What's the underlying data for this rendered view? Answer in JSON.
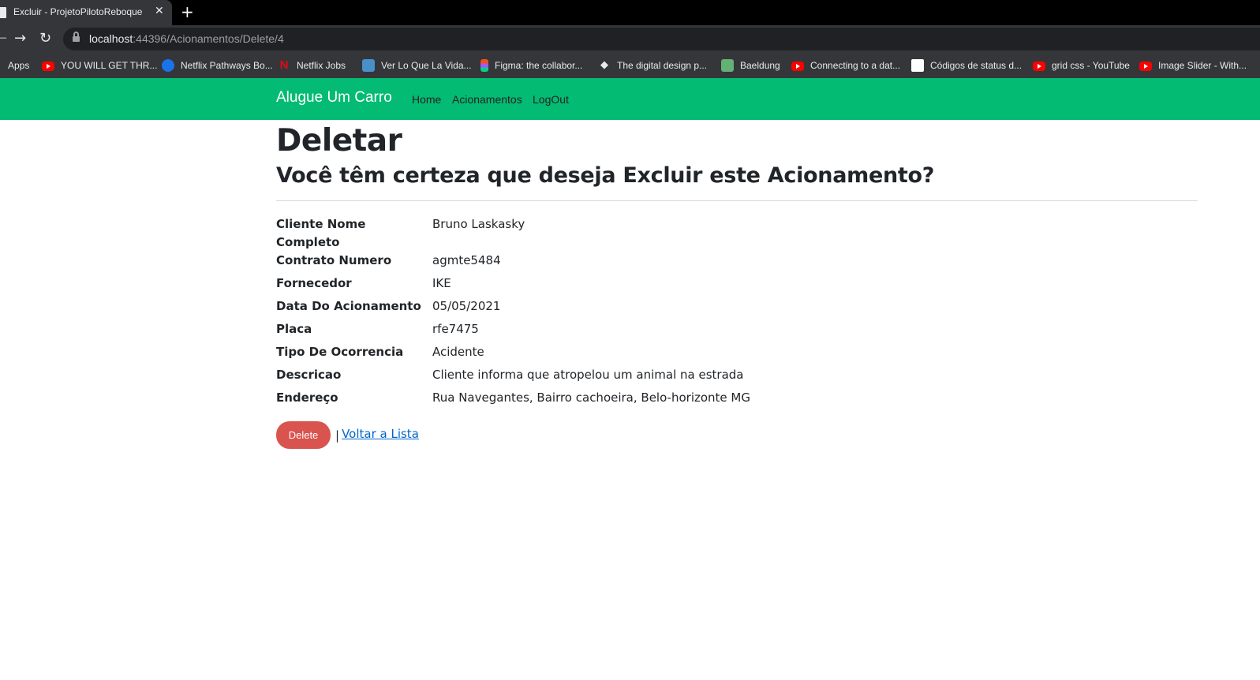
{
  "browser": {
    "tab_title": "Excluir - ProjetoPilotoReboque",
    "url_host": "localhost",
    "url_path": ":44396/Acionamentos/Delete/4",
    "bookmarks": [
      {
        "label": "Apps",
        "icon": "apps-icon"
      },
      {
        "label": "YOU WILL GET THR...",
        "icon": "youtube-icon"
      },
      {
        "label": "Netflix Pathways Bo...",
        "icon": "2u-icon"
      },
      {
        "label": "Netflix Jobs",
        "icon": "netflix-icon"
      },
      {
        "label": "Ver Lo Que La Vida...",
        "icon": "image-icon"
      },
      {
        "label": "Figma: the collabor...",
        "icon": "figma-icon"
      },
      {
        "label": "The digital design p...",
        "icon": "diamond-icon"
      },
      {
        "label": "Baeldung",
        "icon": "baeldung-icon"
      },
      {
        "label": "Connecting to a dat...",
        "icon": "youtube-icon"
      },
      {
        "label": "Códigos de status d...",
        "icon": "http-icon"
      },
      {
        "label": "grid css - YouTube",
        "icon": "youtube-icon"
      },
      {
        "label": "Image Slider - With...",
        "icon": "youtube-icon"
      }
    ]
  },
  "navbar": {
    "brand": "Alugue Um Carro",
    "links": [
      "Home",
      "Acionamentos",
      "LogOut"
    ],
    "color": "#03bb72"
  },
  "page": {
    "title": "Deletar",
    "subtitle": "Você têm certeza que deseja Excluir este Acionamento?",
    "fields": [
      {
        "label": "Cliente Nome Completo",
        "value": "Bruno Laskasky"
      },
      {
        "label": "Contrato Numero",
        "value": "agmte5484"
      },
      {
        "label": "Fornecedor",
        "value": "IKE"
      },
      {
        "label": "Data Do Acionamento",
        "value": "05/05/2021"
      },
      {
        "label": "Placa",
        "value": "rfe7475"
      },
      {
        "label": "Tipo De Ocorrencia",
        "value": "Acidente"
      },
      {
        "label": "Descricao",
        "value": "Cliente informa que atropelou um animal na estrada"
      },
      {
        "label": "Endereço",
        "value": "Rua Navegantes, Bairro cachoeira, Belo-horizonte MG"
      }
    ],
    "delete_label": "Delete",
    "separator": "|",
    "back_label": "Voltar a Lista",
    "delete_color": "#d9534f"
  }
}
